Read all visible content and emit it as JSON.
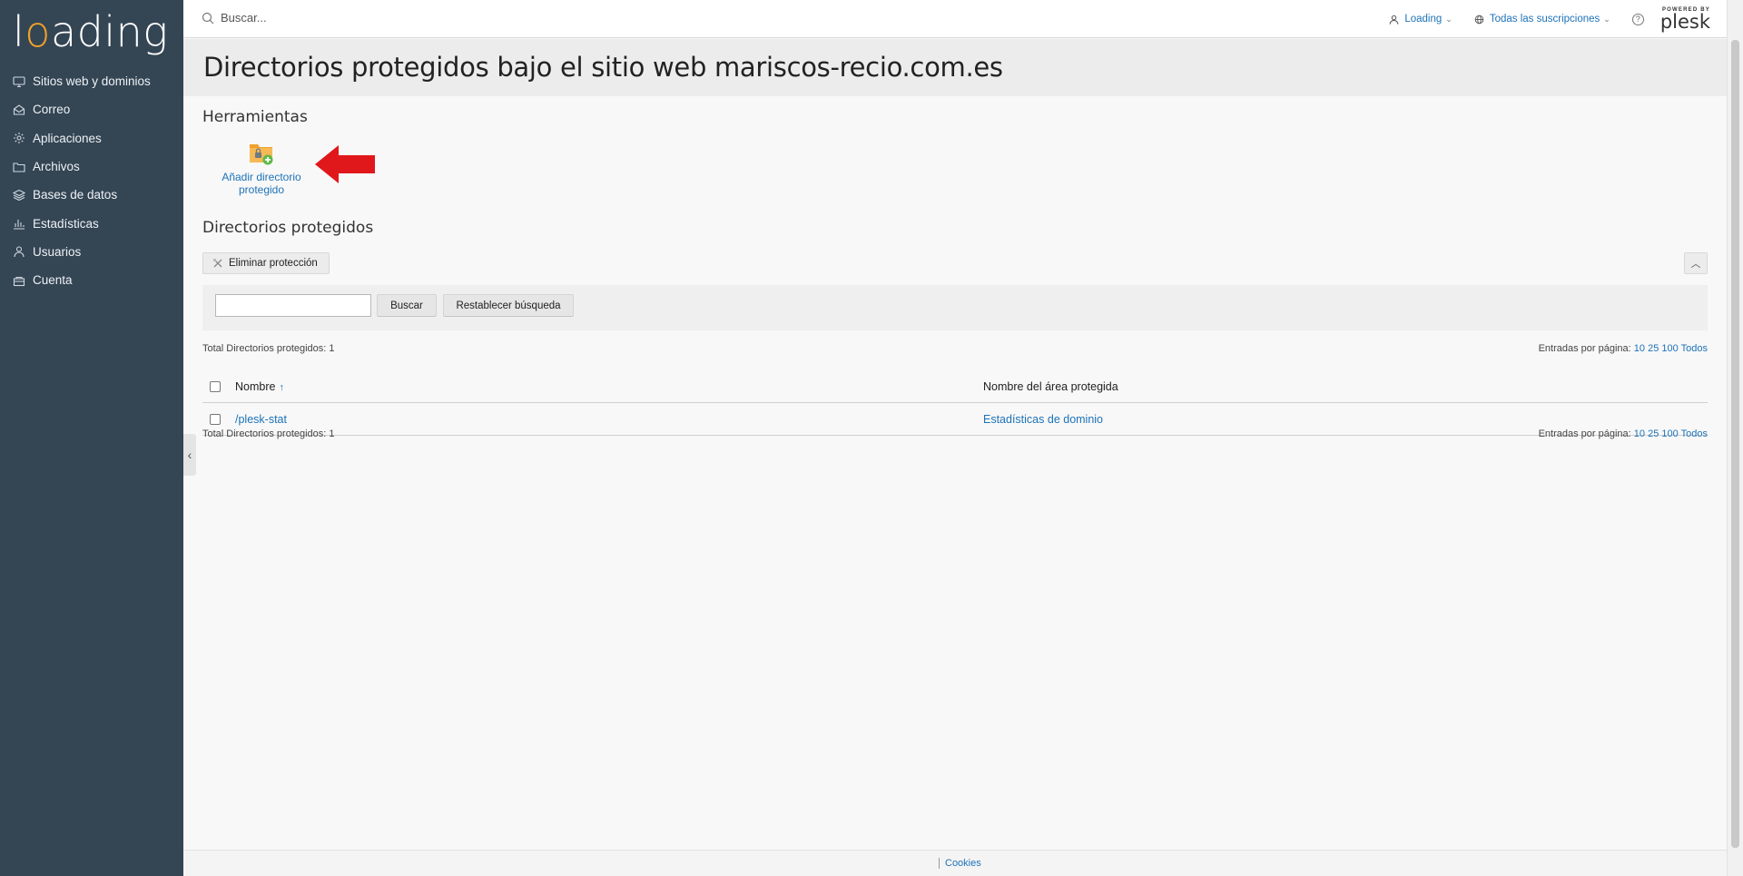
{
  "brand": {
    "logo_text_1": "l",
    "logo_text_o": "o",
    "logo_text_2": "ading",
    "accent_color": "#f0a12c",
    "sidebar_color": "#344554",
    "link_color": "#1d72b8"
  },
  "sidebar": {
    "items": [
      {
        "label": "Sitios web y dominios",
        "icon": "monitor-icon"
      },
      {
        "label": "Correo",
        "icon": "mail-icon"
      },
      {
        "label": "Aplicaciones",
        "icon": "gear-icon"
      },
      {
        "label": "Archivos",
        "icon": "folder-icon"
      },
      {
        "label": "Bases de datos",
        "icon": "database-icon"
      },
      {
        "label": "Estadísticas",
        "icon": "bar-chart-icon"
      },
      {
        "label": "Usuarios",
        "icon": "user-icon"
      },
      {
        "label": "Cuenta",
        "icon": "account-icon"
      }
    ]
  },
  "topbar": {
    "search_placeholder": "Buscar...",
    "user_label": "Loading",
    "subscriptions_label": "Todas las suscripciones",
    "help_label": "?",
    "powered_by": "POWERED BY",
    "plesk": "plesk"
  },
  "page": {
    "title": "Directorios protegidos bajo el sitio web mariscos-recio.com.es"
  },
  "tools": {
    "section_title": "Herramientas",
    "add_protected_dir_label_1": "Añadir directorio",
    "add_protected_dir_label_2": "protegido"
  },
  "protected": {
    "section_title": "Directorios protegidos",
    "remove_protection_label": "Eliminar protección",
    "collapse_label": "^",
    "search_button": "Buscar",
    "reset_button": "Restablecer búsqueda",
    "search_value": "",
    "total_text": "Total Directorios protegidos: 1",
    "per_page_label": "Entradas por página:",
    "per_page_options": [
      "10",
      "25",
      "100",
      "Todos"
    ],
    "columns": {
      "name": "Nombre",
      "sort_indicator": "↑",
      "area": "Nombre del área protegida"
    },
    "rows": [
      {
        "name": "/plesk-stat",
        "area": "Estadísticas de dominio"
      }
    ]
  },
  "footer": {
    "cookies": "Cookies"
  }
}
